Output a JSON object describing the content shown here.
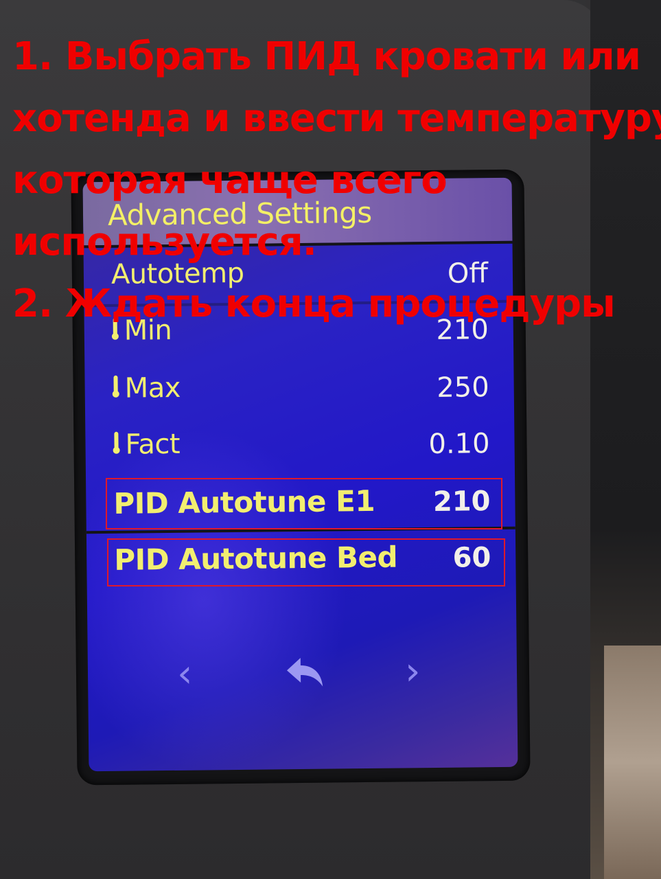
{
  "screen": {
    "title": "Advanced Settings",
    "items": [
      {
        "label": "Autotemp",
        "value": "Off"
      },
      {
        "label": "Min",
        "value": "210"
      },
      {
        "label": "Max",
        "value": "250"
      },
      {
        "label": "Fact",
        "value": "0.10"
      },
      {
        "label": "PID Autotune E1",
        "value": "210"
      },
      {
        "label": "PID Autotune Bed",
        "value": "60"
      }
    ],
    "nav": {
      "prev_icon": "chevron-left-icon",
      "back_icon": "back-arrow-icon",
      "next_icon": "chevron-right-icon"
    }
  },
  "overlay": {
    "lines": [
      "1. Выбрать ПИД кровати или",
      "хотенда и ввести температуру,",
      "которая чаще всего",
      "используется.",
      "2. Ждать конца процедуры"
    ]
  },
  "colors": {
    "screen_bg": "#2218c8",
    "label_text": "#f2ee70",
    "value_text": "#f2f0e8",
    "annotation": "#f00000",
    "highlight_border": "#e0182a"
  }
}
